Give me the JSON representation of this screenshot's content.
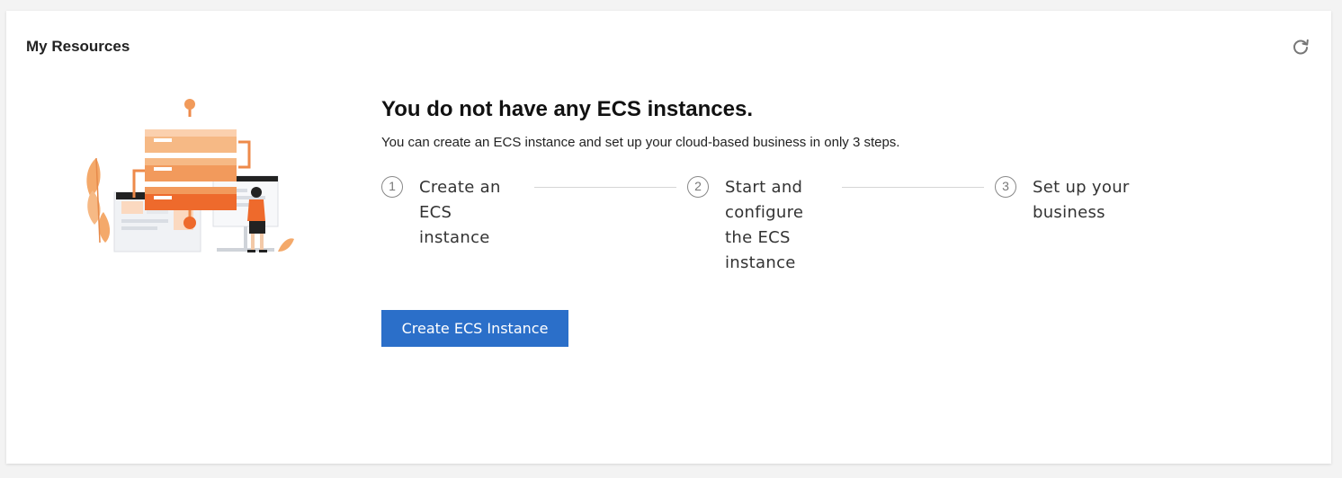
{
  "panel": {
    "title": "My Resources",
    "refresh_icon": "refresh-icon"
  },
  "empty_state": {
    "illustration": "server-person-illustration",
    "headline": "You do not have any ECS instances.",
    "description": "You can create an ECS instance and set up your cloud-based business in only 3 steps.",
    "steps": [
      {
        "number": "1",
        "label": "Create an ECS instance"
      },
      {
        "number": "2",
        "label": "Start and configure the ECS instance"
      },
      {
        "number": "3",
        "label": "Set up your business"
      }
    ],
    "cta_label": "Create ECS Instance"
  },
  "colors": {
    "accent": "#2b6fc9",
    "illustration_orange": "#ee6a2c"
  }
}
